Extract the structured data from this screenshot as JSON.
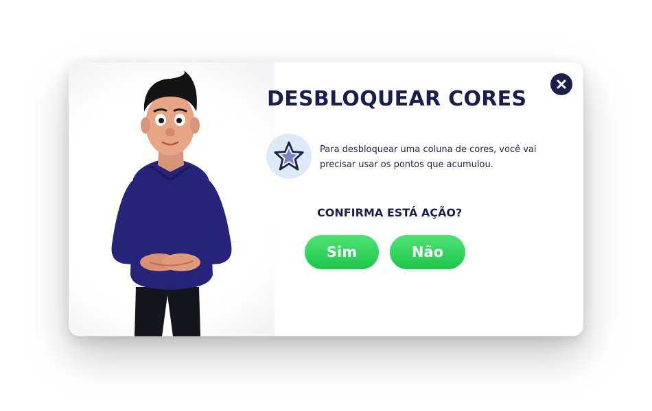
{
  "dialog": {
    "title": "DESBLOQUEAR CORES",
    "message": "Para desbloquear uma coluna de cores, você vai precisar usar os pontos que acumulou.",
    "question": "CONFIRMA ESTÁ AÇÃO?",
    "yes_label": "Sim",
    "no_label": "Não",
    "close_icon": "close-icon",
    "info_icon": "star-icon"
  },
  "colors": {
    "primary_dark": "#1b1d4a",
    "button_green": "#2bd356",
    "icon_bg": "#dcebf7",
    "star": "#1b1d4a",
    "star_fill": "#7d86c4"
  }
}
